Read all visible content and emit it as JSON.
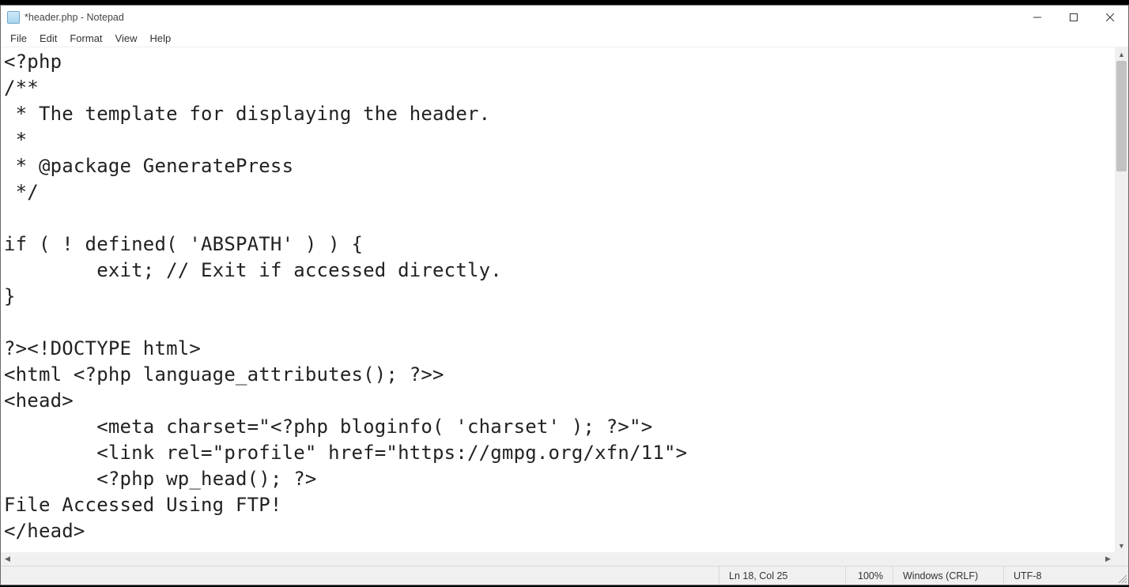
{
  "window": {
    "title": "*header.php - Notepad"
  },
  "menu": {
    "file": "File",
    "edit": "Edit",
    "format": "Format",
    "view": "View",
    "help": "Help"
  },
  "editor": {
    "content": "<?php\n/**\n * The template for displaying the header.\n *\n * @package GeneratePress\n */\n\nif ( ! defined( 'ABSPATH' ) ) {\n\texit; // Exit if accessed directly.\n}\n\n?><!DOCTYPE html>\n<html <?php language_attributes(); ?>>\n<head>\n\t<meta charset=\"<?php bloginfo( 'charset' ); ?>\">\n\t<link rel=\"profile\" href=\"https://gmpg.org/xfn/11\">\n\t<?php wp_head(); ?>\nFile Accessed Using FTP!\n</head>"
  },
  "status": {
    "position": "Ln 18, Col 25",
    "zoom": "100%",
    "eol": "Windows (CRLF)",
    "encoding": "UTF-8"
  }
}
